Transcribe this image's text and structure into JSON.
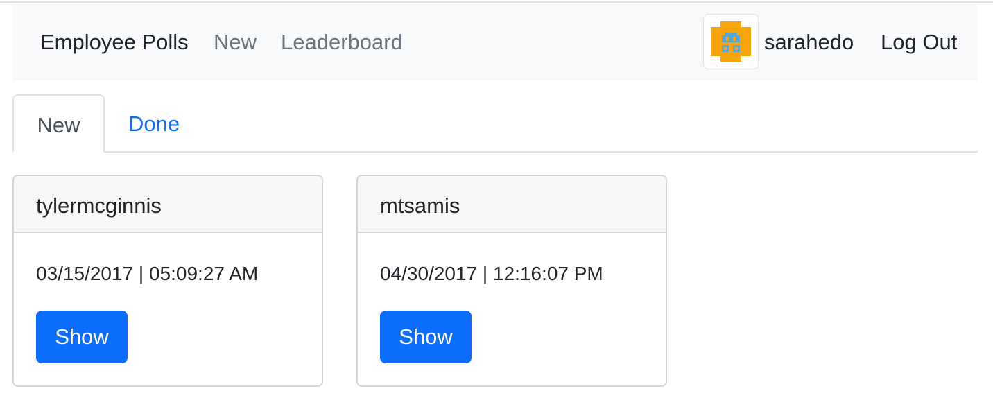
{
  "navbar": {
    "brand": "Employee Polls",
    "links": [
      "New",
      "Leaderboard"
    ],
    "user": {
      "avatar_icon": "pixel-avatar-icon",
      "name": "sarahedo"
    },
    "logout_label": "Log Out"
  },
  "tabs": [
    {
      "label": "New",
      "active": true
    },
    {
      "label": "Done",
      "active": false
    }
  ],
  "polls": [
    {
      "author": "tylermcginnis",
      "timestamp": "03/15/2017 | 05:09:27 AM",
      "button_label": "Show"
    },
    {
      "author": "mtsamis",
      "timestamp": "04/30/2017 | 12:16:07 PM",
      "button_label": "Show"
    }
  ],
  "colors": {
    "accent": "#0d6efd",
    "navbar_bg": "#f8f9fa",
    "avatar_orange": "#f7a50d",
    "avatar_blue": "#5aa5d8"
  }
}
